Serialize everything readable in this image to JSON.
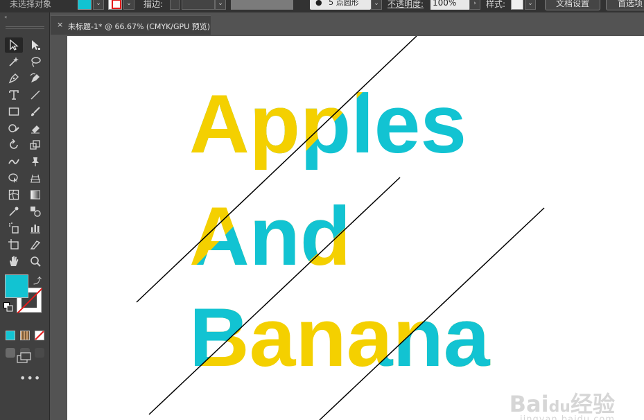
{
  "control_bar": {
    "selection_label": "未选择对象",
    "stroke_label": "描边:",
    "brush_label": "5 点圆形",
    "opacity_label": "不透明度:",
    "opacity_value": "100%",
    "style_label": "样式:",
    "doc_setup_button": "文档设置",
    "preferences_button": "首选项",
    "fill_color": "#12c3d2"
  },
  "document_tab": {
    "close_glyph": "×",
    "title": "未标题-1* @ 66.67% (CMYK/GPU 预览)"
  },
  "artwork": {
    "words": [
      {
        "text": "Apples",
        "split": 3
      },
      {
        "text": "And",
        "split": 1
      },
      {
        "text": "Banana",
        "split": 4
      }
    ],
    "colors": {
      "yellow": "#f4d000",
      "cyan": "#12c3d2",
      "line": "#000000"
    }
  },
  "toolbar": {
    "fill_color": "#12c3d2",
    "stroke_color": "none",
    "more_glyph": "•••"
  },
  "watermark": {
    "brand": "Bai",
    "brand_suffix": "经验",
    "paw": "du",
    "url": "jingyan.baidu.com"
  }
}
